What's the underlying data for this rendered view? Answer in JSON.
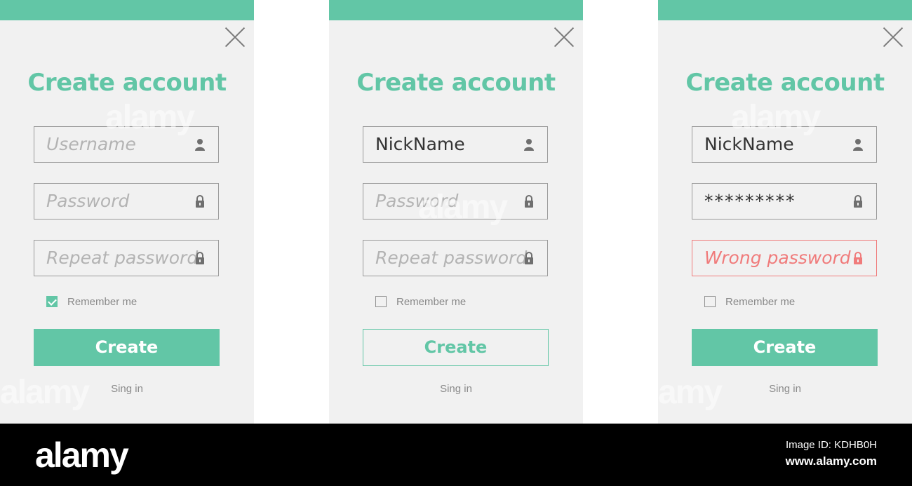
{
  "colors": {
    "accent": "#62c6a6",
    "error": "#f07b7b",
    "panel_bg": "#f1f1f1"
  },
  "panels": [
    {
      "title": "Create account",
      "username": {
        "placeholder": "Username",
        "value": ""
      },
      "password": {
        "placeholder": "Password",
        "value": ""
      },
      "repeat": {
        "placeholder": "Repeat password",
        "value": ""
      },
      "remember": {
        "label": "Remember me",
        "checked": true
      },
      "button": {
        "label": "Create",
        "style": "filled"
      },
      "signin": "Sing in"
    },
    {
      "title": "Create account",
      "username": {
        "placeholder": "Username",
        "value": "NickName"
      },
      "password": {
        "placeholder": "Password",
        "value": ""
      },
      "repeat": {
        "placeholder": "Repeat password",
        "value": ""
      },
      "remember": {
        "label": "Remember me",
        "checked": false
      },
      "button": {
        "label": "Create",
        "style": "outline"
      },
      "signin": "Sing in"
    },
    {
      "title": "Create account",
      "username": {
        "placeholder": "Username",
        "value": "NickName"
      },
      "password": {
        "placeholder": "Password",
        "value": "*********"
      },
      "repeat": {
        "placeholder": "Repeat password",
        "value": "",
        "error": "Wrong password"
      },
      "remember": {
        "label": "Remember me",
        "checked": false
      },
      "button": {
        "label": "Create",
        "style": "filled"
      },
      "signin": "Sing in"
    }
  ],
  "footer": {
    "brand": "alamy",
    "image_id": "Image ID: KDHB0H",
    "site": "www.alamy.com"
  },
  "watermark": "alamy"
}
